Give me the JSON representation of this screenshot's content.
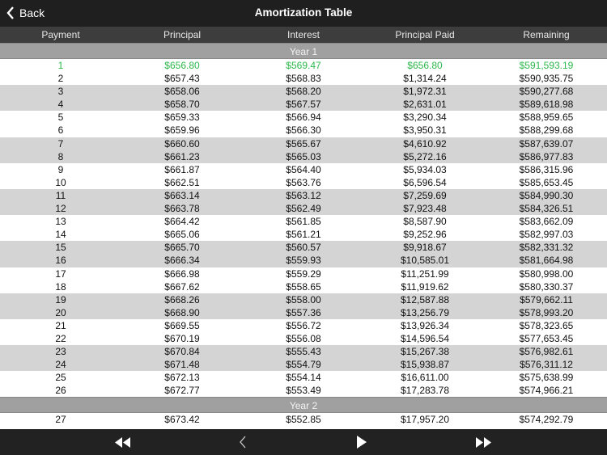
{
  "navbar": {
    "back_label": "Back",
    "title": "Amortization Table"
  },
  "columns": [
    "Payment",
    "Principal",
    "Interest",
    "Principal Paid",
    "Remaining"
  ],
  "highlight_color": "#2db84d",
  "sections": [
    {
      "label": "Year 1",
      "rows": [
        [
          "1",
          "$656.80",
          "$569.47",
          "$656.80",
          "$591,593.19"
        ],
        [
          "2",
          "$657.43",
          "$568.83",
          "$1,314.24",
          "$590,935.75"
        ],
        [
          "3",
          "$658.06",
          "$568.20",
          "$1,972.31",
          "$590,277.68"
        ],
        [
          "4",
          "$658.70",
          "$567.57",
          "$2,631.01",
          "$589,618.98"
        ],
        [
          "5",
          "$659.33",
          "$566.94",
          "$3,290.34",
          "$588,959.65"
        ],
        [
          "6",
          "$659.96",
          "$566.30",
          "$3,950.31",
          "$588,299.68"
        ],
        [
          "7",
          "$660.60",
          "$565.67",
          "$4,610.92",
          "$587,639.07"
        ],
        [
          "8",
          "$661.23",
          "$565.03",
          "$5,272.16",
          "$586,977.83"
        ],
        [
          "9",
          "$661.87",
          "$564.40",
          "$5,934.03",
          "$586,315.96"
        ],
        [
          "10",
          "$662.51",
          "$563.76",
          "$6,596.54",
          "$585,653.45"
        ],
        [
          "11",
          "$663.14",
          "$563.12",
          "$7,259.69",
          "$584,990.30"
        ],
        [
          "12",
          "$663.78",
          "$562.49",
          "$7,923.48",
          "$584,326.51"
        ],
        [
          "13",
          "$664.42",
          "$561.85",
          "$8,587.90",
          "$583,662.09"
        ],
        [
          "14",
          "$665.06",
          "$561.21",
          "$9,252.96",
          "$582,997.03"
        ],
        [
          "15",
          "$665.70",
          "$560.57",
          "$9,918.67",
          "$582,331.32"
        ],
        [
          "16",
          "$666.34",
          "$559.93",
          "$10,585.01",
          "$581,664.98"
        ],
        [
          "17",
          "$666.98",
          "$559.29",
          "$11,251.99",
          "$580,998.00"
        ],
        [
          "18",
          "$667.62",
          "$558.65",
          "$11,919.62",
          "$580,330.37"
        ],
        [
          "19",
          "$668.26",
          "$558.00",
          "$12,587.88",
          "$579,662.11"
        ],
        [
          "20",
          "$668.90",
          "$557.36",
          "$13,256.79",
          "$578,993.20"
        ],
        [
          "21",
          "$669.55",
          "$556.72",
          "$13,926.34",
          "$578,323.65"
        ],
        [
          "22",
          "$670.19",
          "$556.08",
          "$14,596.54",
          "$577,653.45"
        ],
        [
          "23",
          "$670.84",
          "$555.43",
          "$15,267.38",
          "$576,982.61"
        ],
        [
          "24",
          "$671.48",
          "$554.79",
          "$15,938.87",
          "$576,311.12"
        ],
        [
          "25",
          "$672.13",
          "$554.14",
          "$16,611.00",
          "$575,638.99"
        ],
        [
          "26",
          "$672.77",
          "$553.49",
          "$17,283.78",
          "$574,966.21"
        ]
      ]
    },
    {
      "label": "Year 2",
      "rows": [
        [
          "27",
          "$673.42",
          "$552.85",
          "$17,957.20",
          "$574,292.79"
        ]
      ]
    }
  ],
  "highlighted_payment": "1",
  "toolbar": [
    "rewind-icon",
    "chevron-left-icon",
    "play-icon",
    "fast-forward-icon"
  ]
}
